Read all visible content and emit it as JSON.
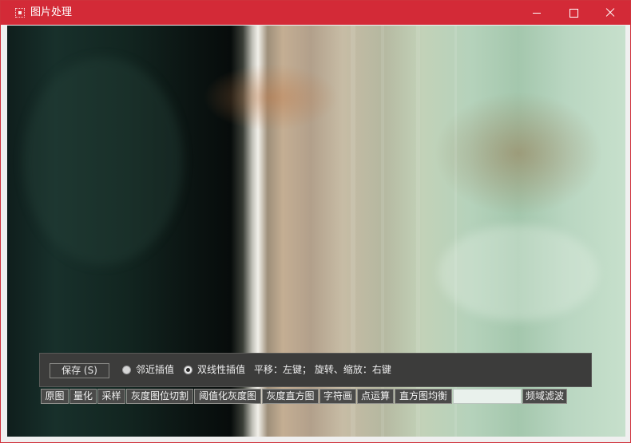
{
  "window": {
    "title": "图片处理",
    "accent_color": "#d32a37"
  },
  "controls": {
    "save_label": "保存 (S)",
    "radio_nearest": {
      "label": "邻近插值",
      "selected": false
    },
    "radio_bilinear": {
      "label": "双线性插值",
      "selected": true
    },
    "hint": "平移：左键；  旋转、缩放：右键"
  },
  "toolbar": {
    "buttons": [
      "原图",
      "量化",
      "采样",
      "灰度图位切割",
      "阈值化灰度图",
      "灰度直方图",
      "字符画",
      "点运算",
      "直方图均衡"
    ],
    "input_value": "",
    "last_button": "频域滤波"
  }
}
